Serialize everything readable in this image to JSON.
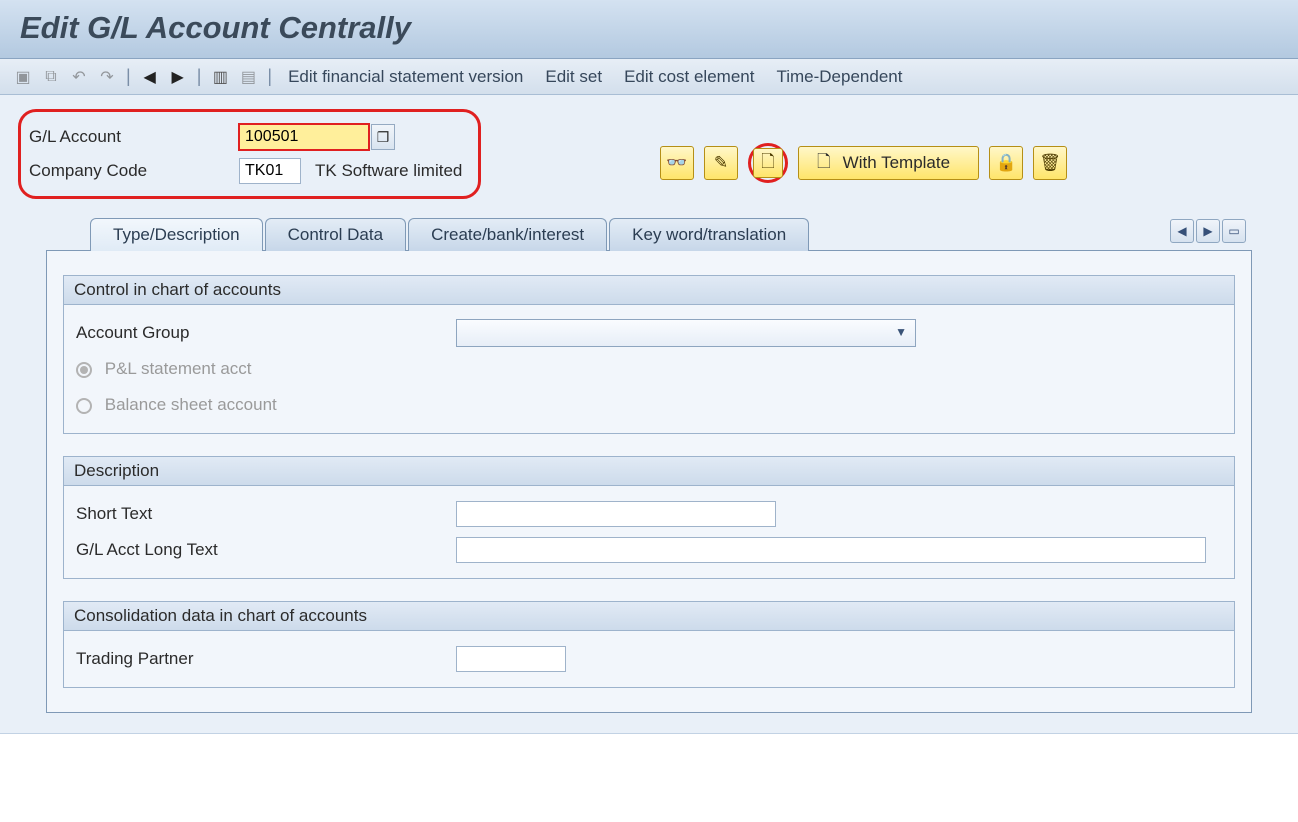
{
  "title": "Edit G/L Account Centrally",
  "toolbar": {
    "icons": [
      "gray1",
      "gray2",
      "undo",
      "redo",
      "prev",
      "next",
      "dates",
      "doc"
    ],
    "links": {
      "edit_fsv": "Edit financial statement version",
      "edit_set": "Edit set",
      "edit_cost_element": "Edit cost element",
      "time_dependent": "Time-Dependent"
    }
  },
  "keys": {
    "gl_account": {
      "label": "G/L Account",
      "value": "100501"
    },
    "company_code": {
      "label": "Company Code",
      "value": "TK01",
      "desc": "TK Software limited"
    }
  },
  "actions": {
    "with_template": "With Template"
  },
  "tabs": {
    "type_desc": "Type/Description",
    "control_data": "Control Data",
    "create_bank": "Create/bank/interest",
    "keyword": "Key word/translation"
  },
  "groups": {
    "control_chart": {
      "title": "Control in chart of accounts",
      "account_group": "Account Group",
      "pl_stmt": "P&L statement acct",
      "balance_sheet": "Balance sheet account"
    },
    "description": {
      "title": "Description",
      "short_text": "Short Text",
      "long_text": "G/L Acct Long Text"
    },
    "consolidation": {
      "title": "Consolidation data in chart of accounts",
      "trading_partner": "Trading Partner"
    }
  }
}
